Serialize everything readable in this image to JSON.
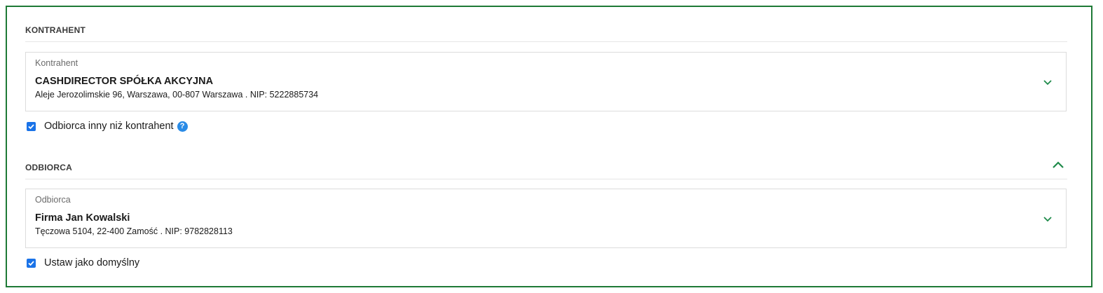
{
  "contractor_section": {
    "title": "KONTRAHENT",
    "field": {
      "label": "Kontrahent",
      "name": "CASHDIRECTOR SPÓŁKA AKCYJNA",
      "details": "Aleje Jerozolimskie 96, Warszawa, 00-807 Warszawa . NIP: 5222885734",
      "icon": "chevron-down-icon"
    },
    "checkbox": {
      "label": "Odbiorca inny niż kontrahent",
      "checked": true,
      "help_icon": "?"
    }
  },
  "recipient_section": {
    "title": "ODBIORCA",
    "collapse_icon": "chevron-up-icon",
    "field": {
      "label": "Odbiorca",
      "name": "Firma Jan Kowalski",
      "details": "Tęczowa 5104, 22-400 Zamość . NIP: 9782828113",
      "icon": "chevron-down-icon"
    },
    "checkbox": {
      "label": "Ustaw jako domyślny",
      "checked": true
    }
  },
  "colors": {
    "frame_border": "#1e7a36",
    "accent_green": "#1e8a4a",
    "checkbox_blue": "#1a73e8",
    "help_blue": "#2a8be6"
  }
}
